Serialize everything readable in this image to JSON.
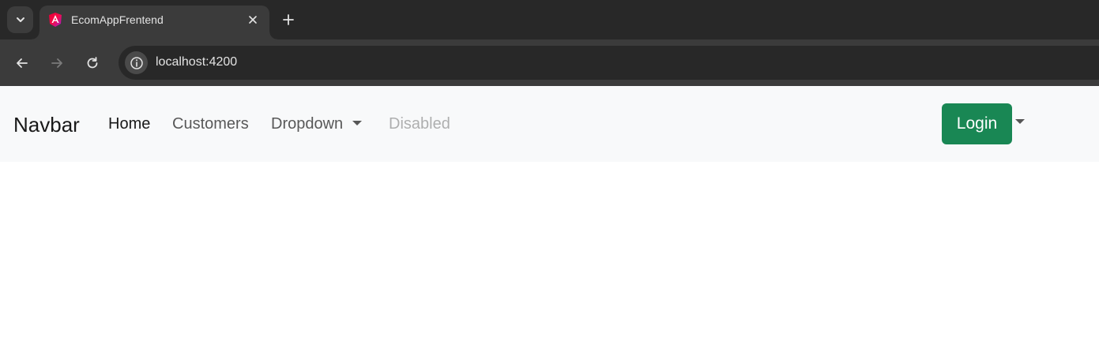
{
  "browser": {
    "tab": {
      "title": "EcomAppFrentend",
      "favicon": "angular-icon"
    },
    "address_bar": {
      "url": "localhost:4200"
    },
    "icons": {
      "tab_search": "chevron-down-icon",
      "close_tab": "close-icon",
      "new_tab": "plus-icon",
      "back": "arrow-left-icon",
      "forward": "arrow-right-icon",
      "reload": "reload-icon",
      "site_info": "info-icon"
    }
  },
  "navbar": {
    "brand": "Navbar",
    "links": [
      {
        "label": "Home",
        "state": "active"
      },
      {
        "label": "Customers",
        "state": "normal"
      },
      {
        "label": "Dropdown",
        "state": "dropdown"
      },
      {
        "label": "Disabled",
        "state": "disabled"
      }
    ],
    "login_label": "Login",
    "colors": {
      "navbar_bg": "#f8f9fa",
      "login_bg": "#198754"
    }
  }
}
